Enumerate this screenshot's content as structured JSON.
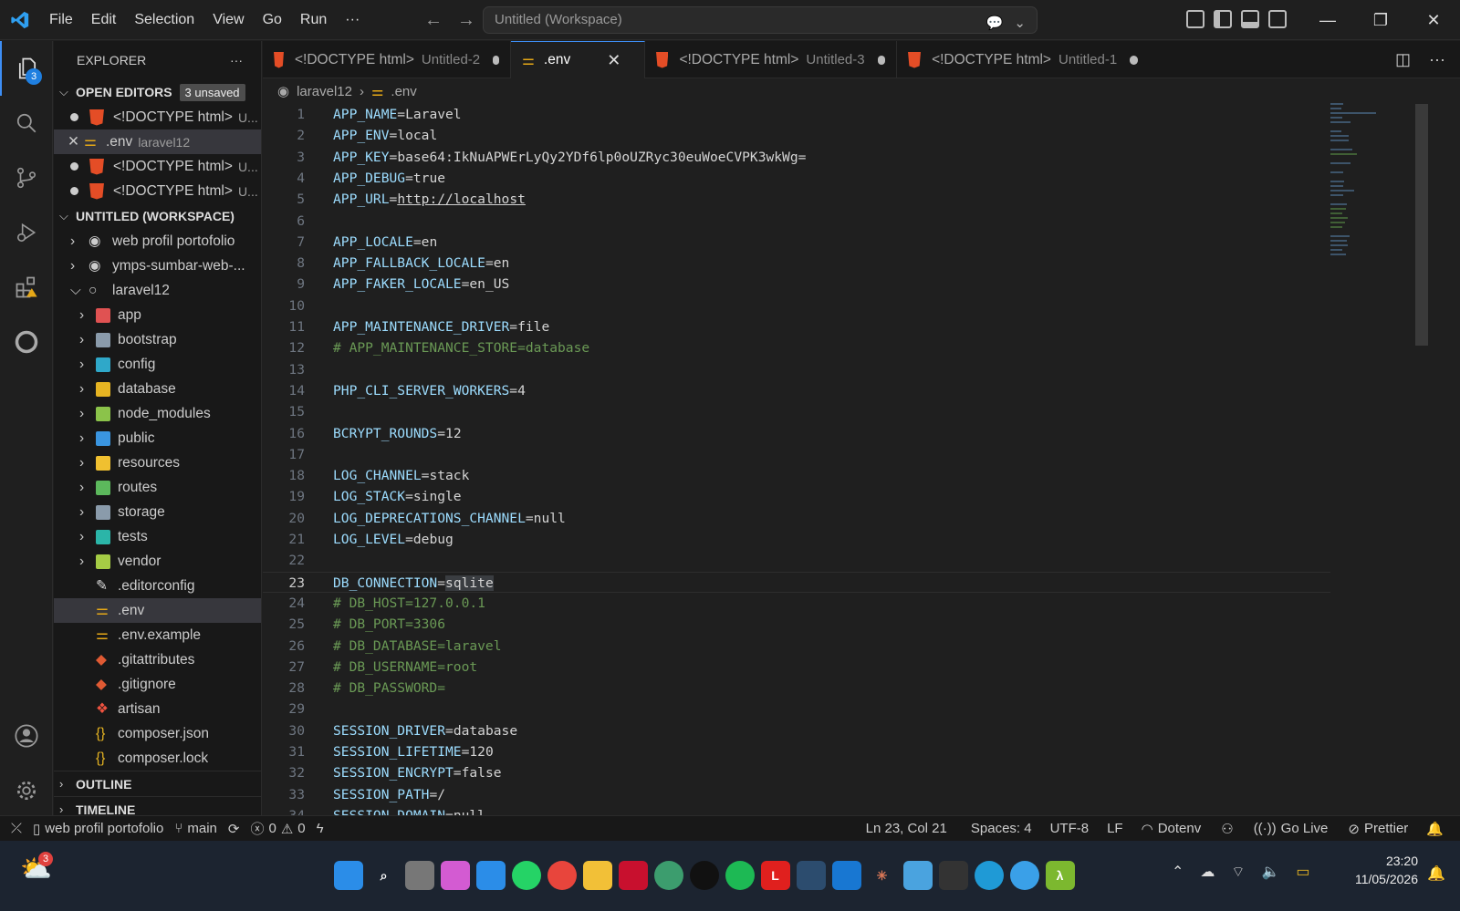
{
  "menu": [
    "File",
    "Edit",
    "Selection",
    "View",
    "Go",
    "Run",
    "···"
  ],
  "command_center": "Untitled (Workspace)",
  "activity": {
    "explorer_badge": "3"
  },
  "sidebar": {
    "title": "EXPLORER",
    "more": "···",
    "open_editors": {
      "title": "OPEN EDITORS",
      "badge": "3 unsaved",
      "items": [
        {
          "name": "<!DOCTYPE html>",
          "desc": "U..."
        },
        {
          "name": ".env",
          "desc": "laravel12"
        },
        {
          "name": "<!DOCTYPE html>",
          "desc": "U..."
        },
        {
          "name": "<!DOCTYPE html>",
          "desc": "U..."
        }
      ]
    },
    "workspace": {
      "title": "UNTITLED (WORKSPACE)",
      "roots": [
        "web profil portofolio",
        "ymps-sumbar-web-...",
        "laravel12"
      ],
      "folders": [
        "app",
        "bootstrap",
        "config",
        "database",
        "node_modules",
        "public",
        "resources",
        "routes",
        "storage",
        "tests",
        "vendor"
      ],
      "files": [
        ".editorconfig",
        ".env",
        ".env.example",
        ".gitattributes",
        ".gitignore",
        "artisan",
        "composer.json",
        "composer.lock"
      ]
    },
    "outline": "OUTLINE",
    "timeline": "TIMELINE"
  },
  "tabs": [
    {
      "name": "<!DOCTYPE html>",
      "desc": "Untitled-2"
    },
    {
      "name": ".env",
      "desc": ""
    },
    {
      "name": "<!DOCTYPE html>",
      "desc": "Untitled-3"
    },
    {
      "name": "<!DOCTYPE html>",
      "desc": "Untitled-1"
    }
  ],
  "breadcrumb": {
    "folder": "laravel12",
    "file": ".env"
  },
  "code": [
    "APP_NAME=Laravel",
    "APP_ENV=local",
    "APP_KEY=base64:IkNuAPWErLyQy2YDf6lp0oUZRyc30euWoeCVPK3wkWg=",
    "APP_DEBUG=true",
    "APP_URL=http://localhost",
    "",
    "APP_LOCALE=en",
    "APP_FALLBACK_LOCALE=en",
    "APP_FAKER_LOCALE=en_US",
    "",
    "APP_MAINTENANCE_DRIVER=file",
    "# APP_MAINTENANCE_STORE=database",
    "",
    "PHP_CLI_SERVER_WORKERS=4",
    "",
    "BCRYPT_ROUNDS=12",
    "",
    "LOG_CHANNEL=stack",
    "LOG_STACK=single",
    "LOG_DEPRECATIONS_CHANNEL=null",
    "LOG_LEVEL=debug",
    "",
    "DB_CONNECTION=sqlite",
    "# DB_HOST=127.0.0.1",
    "# DB_PORT=3306",
    "# DB_DATABASE=laravel",
    "# DB_USERNAME=root",
    "# DB_PASSWORD=",
    "",
    "SESSION_DRIVER=database",
    "SESSION_LIFETIME=120",
    "SESSION_ENCRYPT=false",
    "SESSION_PATH=/",
    "SESSION_DOMAIN=null"
  ],
  "current_line": 23,
  "status": {
    "remote": "web profil portofolio",
    "branch": "main",
    "errors": "0",
    "warnings": "0",
    "position": "Ln 23, Col 21",
    "spaces": "Spaces: 4",
    "encoding": "UTF-8",
    "eol": "LF",
    "language": "Dotenv",
    "golive": "Go Live",
    "prettier": "Prettier"
  },
  "taskbar": {
    "weather_badge": "3",
    "time": "23:20",
    "date": "11/05/2026"
  }
}
